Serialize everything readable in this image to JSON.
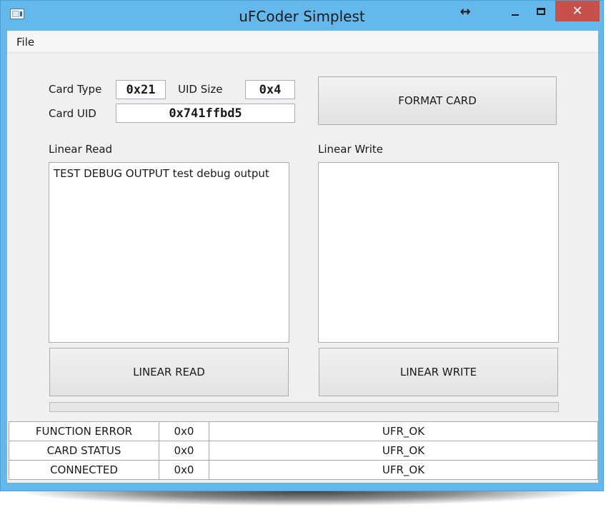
{
  "window": {
    "title": "uFCoder Simplest",
    "title_bar_color": "#65b8ec",
    "close_color": "#c7504a",
    "icons": [
      "app-icon",
      "resize-icon",
      "minimize-icon",
      "maximize-icon",
      "close-icon"
    ],
    "resize_glyph": "↔",
    "close_glyph": "✕"
  },
  "menu": {
    "file": "File"
  },
  "card_info": {
    "card_type_label": "Card Type",
    "card_type_value": "0x21",
    "uid_size_label": "UID Size",
    "uid_size_value": "0x4",
    "card_uid_label": "Card UID",
    "card_uid_value": "0x741ffbd5"
  },
  "buttons": {
    "format_card": "FORMAT CARD",
    "linear_read": "LINEAR READ",
    "linear_write": "LINEAR WRITE"
  },
  "linear_read": {
    "label": "Linear Read",
    "content": "TEST DEBUG OUTPUT test debug output"
  },
  "linear_write": {
    "label": "Linear Write",
    "content": ""
  },
  "progress": {
    "value": 0
  },
  "status_rows": [
    {
      "name": "FUNCTION ERROR",
      "code": "0x0",
      "message": "UFR_OK"
    },
    {
      "name": "CARD STATUS",
      "code": "0x0",
      "message": "UFR_OK"
    },
    {
      "name": "CONNECTED",
      "code": "0x0",
      "message": "UFR_OK"
    }
  ]
}
